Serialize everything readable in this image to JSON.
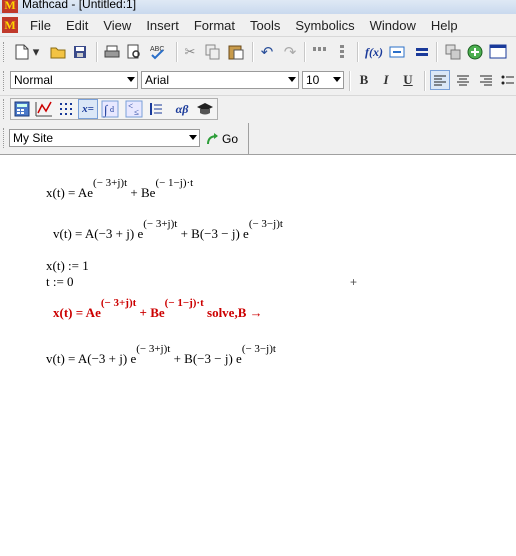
{
  "window": {
    "title": "Mathcad - [Untitled:1]",
    "app_icon": "M"
  },
  "menu": [
    "File",
    "Edit",
    "View",
    "Insert",
    "Format",
    "Tools",
    "Symbolics",
    "Window",
    "Help"
  ],
  "format_bar": {
    "style_value": "Normal",
    "font_value": "Arial",
    "size_value": "10",
    "bold": "B",
    "italic": "I",
    "underline": "U"
  },
  "site_bar": {
    "site_value": "My Site",
    "go_label": "Go"
  },
  "math_toolbar": {
    "eval_label": "x=",
    "greek_label": "αβ"
  },
  "worksheet": {
    "line1": {
      "lhs": "x(t) = Ae",
      "sup1": "(− 3+j)t",
      "mid": " + Be",
      "sup2": "(− 1−j)·t"
    },
    "line2": {
      "lhs": "v(t) = A(−3 + j) e",
      "sup1": "(− 3+j)t",
      "mid": " + B(−3 − j) e",
      "sup2": "(− 3−j)t"
    },
    "def1": "x(t) := 1",
    "def2": "t := 0",
    "line3": {
      "lhs": "x(t) = Ae",
      "sup1": "(− 3+j)t",
      "mid": " + Be",
      "sup2": "(− 1−j)·t",
      "tail": " solve,B →"
    },
    "line4": {
      "lhs": "v(t) = A(−3 + j) e",
      "sup1": "(− 3+j)t",
      "mid": " + B(−3 − j) e",
      "sup2": "(− 3−j)t"
    }
  },
  "colors": {
    "red_expression": "#cc0000"
  }
}
